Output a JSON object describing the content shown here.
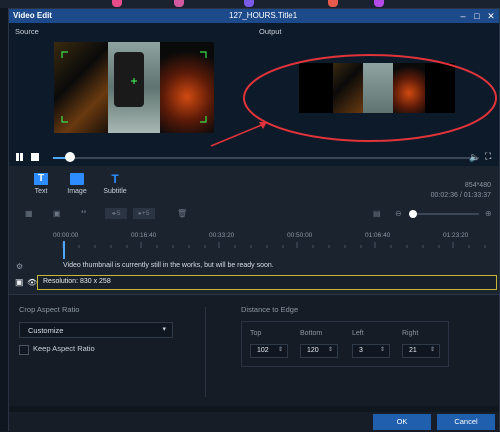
{
  "window": {
    "title": "Video Edit",
    "file_title": "127_HOURS.Title1",
    "controls": [
      "minimize-icon",
      "maximize-icon",
      "close-icon"
    ]
  },
  "preview": {
    "source_label": "Source",
    "output_label": "Output",
    "annotation_color": "#e0343a"
  },
  "playback": {
    "play_state_icon": "pause-icon",
    "progress_fraction": 0.04
  },
  "tools": [
    {
      "icon": "text-icon",
      "label": "Text"
    },
    {
      "icon": "image-icon",
      "label": "Image"
    },
    {
      "icon": "subtitle-icon",
      "label": "Subtitle"
    }
  ],
  "video_info": {
    "resolution": "854*480",
    "time": "00:02:36 / 01:33:37"
  },
  "timeline": {
    "ticks": [
      "00:00:00",
      "00:16:40",
      "00:33:20",
      "00:50:00",
      "01:06:40",
      "01:23:20"
    ],
    "toolbar_labels": {
      "back5": "◂-5",
      "fwd5": "▸+5"
    },
    "notice": "Video thumbnail is currently still in the works, but will be ready soon.",
    "resolution_line": "Resolution: 830 x 258"
  },
  "crop": {
    "title": "Crop Aspect Ratio",
    "aspect_value": "Customize",
    "keep_label": "Keep Aspect Ratio",
    "keep_checked": false,
    "distance_title": "Distance to Edge",
    "fields": [
      {
        "label": "Top",
        "value": "102"
      },
      {
        "label": "Bottom",
        "value": "120"
      },
      {
        "label": "Left",
        "value": "3"
      },
      {
        "label": "Right",
        "value": "21"
      }
    ]
  },
  "footer": {
    "ok_label": "OK",
    "cancel_label": "Cancel"
  },
  "colors": {
    "accent": "#1f5fae",
    "highlight_border": "#c8b63a",
    "playhead": "#4da6ff"
  }
}
